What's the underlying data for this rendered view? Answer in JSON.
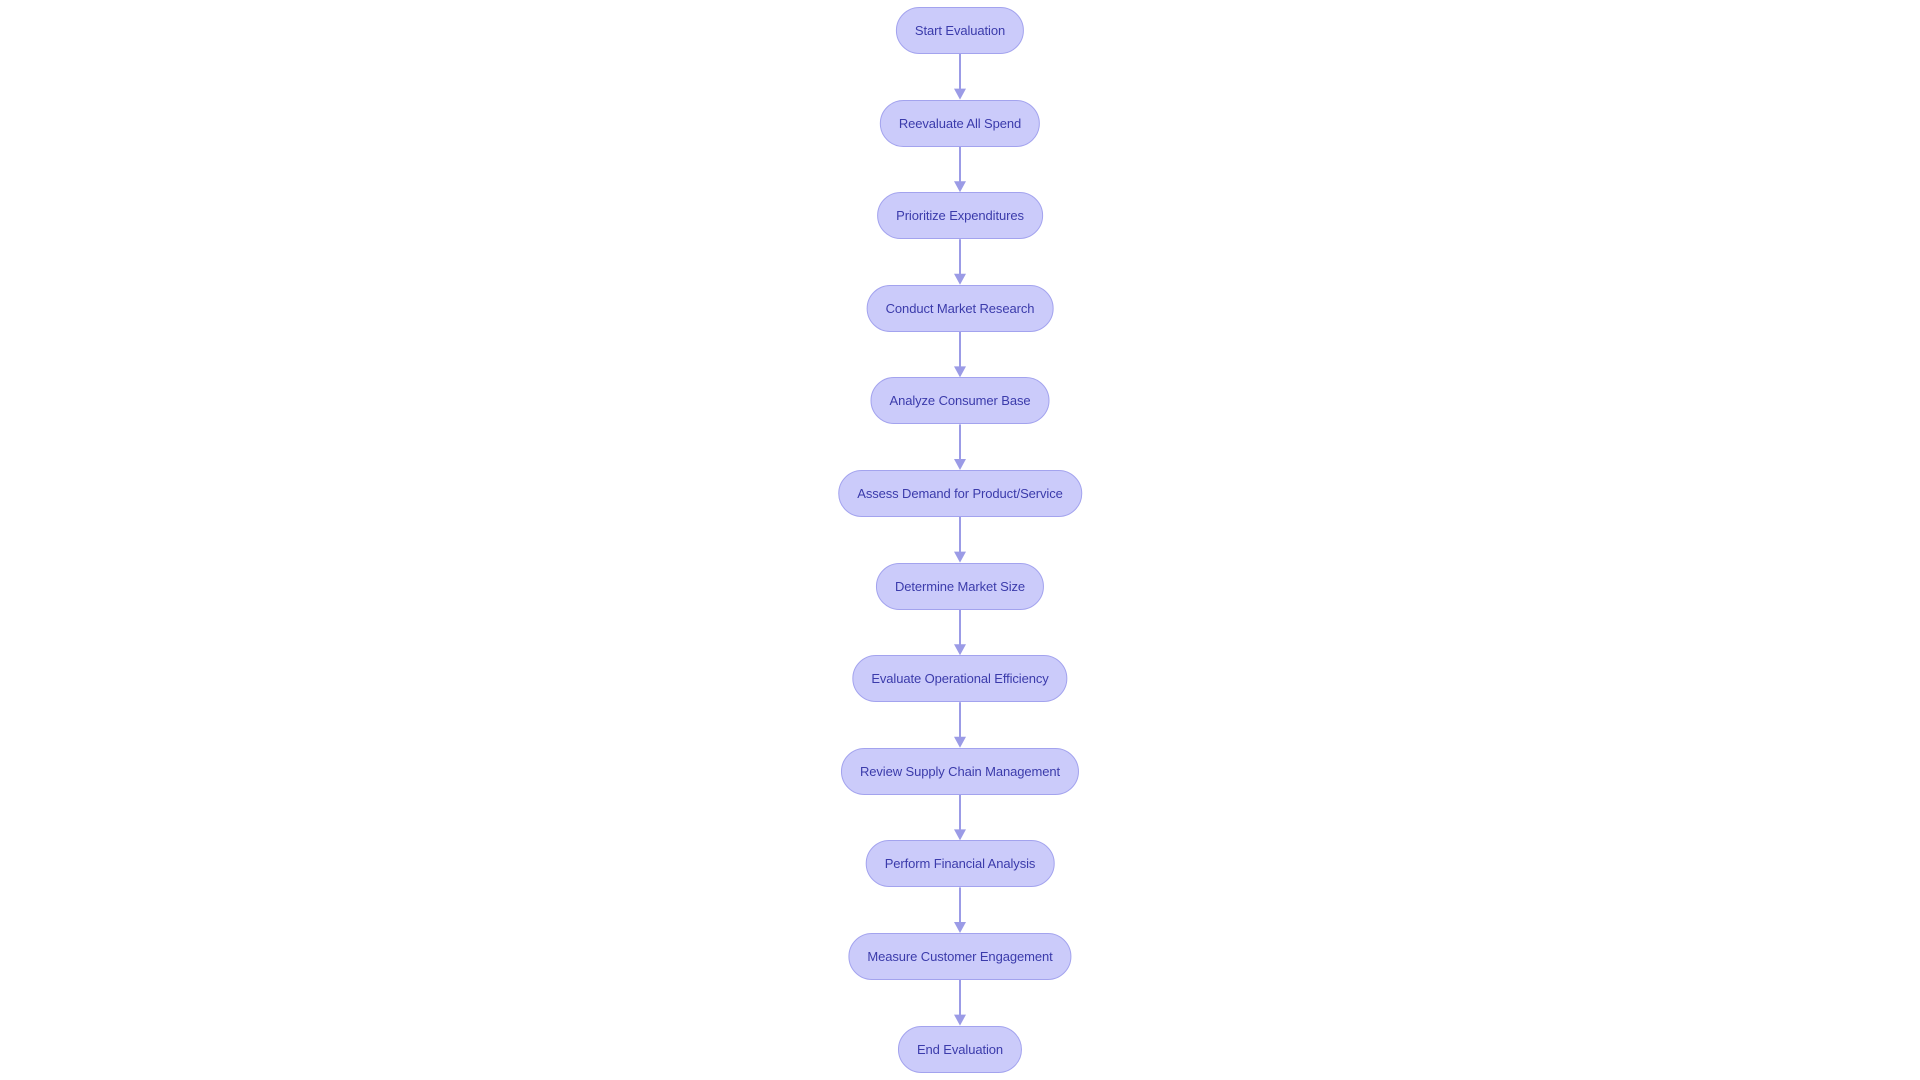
{
  "diagram": {
    "type": "flowchart",
    "direction": "top-to-bottom",
    "colors": {
      "node_fill": "#cbcbfa",
      "node_border": "#a3a3ee",
      "node_text": "#3b3bab",
      "edge": "#9b9be6"
    },
    "nodes": [
      {
        "id": "start",
        "label": "Start Evaluation"
      },
      {
        "id": "reevaluate",
        "label": "Reevaluate All Spend"
      },
      {
        "id": "prioritize",
        "label": "Prioritize Expenditures"
      },
      {
        "id": "research",
        "label": "Conduct Market Research"
      },
      {
        "id": "consumer",
        "label": "Analyze Consumer Base"
      },
      {
        "id": "demand",
        "label": "Assess Demand for Product/Service"
      },
      {
        "id": "market-size",
        "label": "Determine Market Size"
      },
      {
        "id": "efficiency",
        "label": "Evaluate Operational Efficiency"
      },
      {
        "id": "supply-chain",
        "label": "Review Supply Chain Management"
      },
      {
        "id": "financial",
        "label": "Perform Financial Analysis"
      },
      {
        "id": "engagement",
        "label": "Measure Customer Engagement"
      },
      {
        "id": "end",
        "label": "End Evaluation"
      }
    ],
    "edges": [
      {
        "from": "start",
        "to": "reevaluate"
      },
      {
        "from": "reevaluate",
        "to": "prioritize"
      },
      {
        "from": "prioritize",
        "to": "research"
      },
      {
        "from": "research",
        "to": "consumer"
      },
      {
        "from": "consumer",
        "to": "demand"
      },
      {
        "from": "demand",
        "to": "market-size"
      },
      {
        "from": "market-size",
        "to": "efficiency"
      },
      {
        "from": "efficiency",
        "to": "supply-chain"
      },
      {
        "from": "supply-chain",
        "to": "financial"
      },
      {
        "from": "financial",
        "to": "engagement"
      },
      {
        "from": "engagement",
        "to": "end"
      }
    ]
  }
}
